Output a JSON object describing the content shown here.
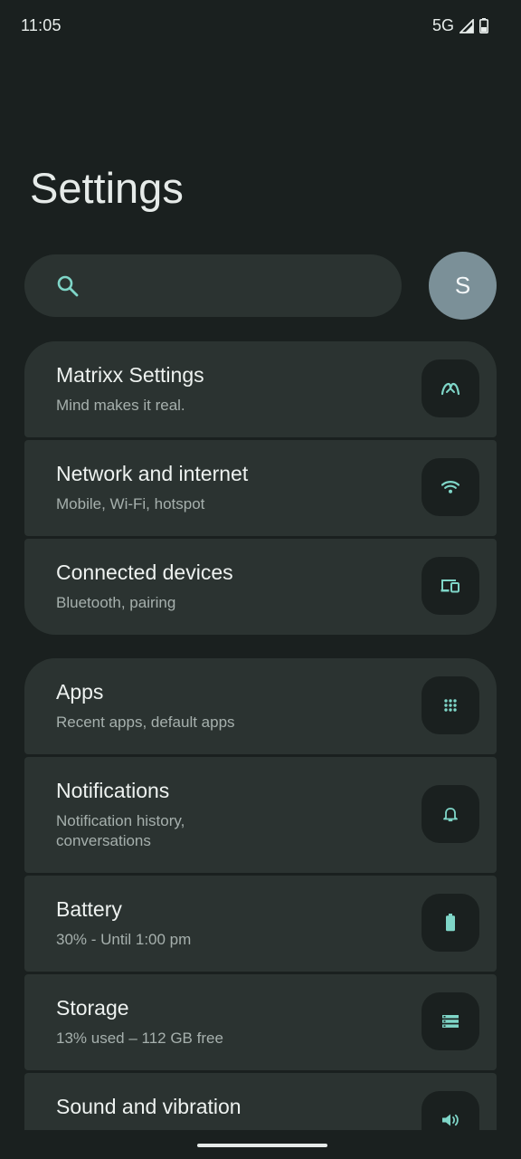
{
  "status": {
    "time": "11:05",
    "network": "5G"
  },
  "title": "Settings",
  "avatar_letter": "S",
  "colors": {
    "background": "#1a201f",
    "card": "#2b3331",
    "accent": "#7fd6c8",
    "avatar": "#7b9098"
  },
  "groups": [
    {
      "items": [
        {
          "title": "Matrixx Settings",
          "subtitle": "Mind makes it real.",
          "icon": "matrixx-logo-icon"
        },
        {
          "title": "Network and internet",
          "subtitle": "Mobile, Wi-Fi, hotspot",
          "icon": "wifi-icon"
        },
        {
          "title": "Connected devices",
          "subtitle": "Bluetooth, pairing",
          "icon": "devices-icon"
        }
      ]
    },
    {
      "items": [
        {
          "title": "Apps",
          "subtitle": "Recent apps, default apps",
          "icon": "apps-grid-icon"
        },
        {
          "title": "Notifications",
          "subtitle": "Notification history, conversations",
          "icon": "bell-icon"
        },
        {
          "title": "Battery",
          "subtitle": "30% - Until 1:00 pm",
          "icon": "battery-icon"
        },
        {
          "title": "Storage",
          "subtitle": "13% used – 112 GB free",
          "icon": "storage-icon"
        },
        {
          "title": "Sound and vibration",
          "subtitle": "",
          "icon": "volume-icon"
        }
      ]
    }
  ]
}
